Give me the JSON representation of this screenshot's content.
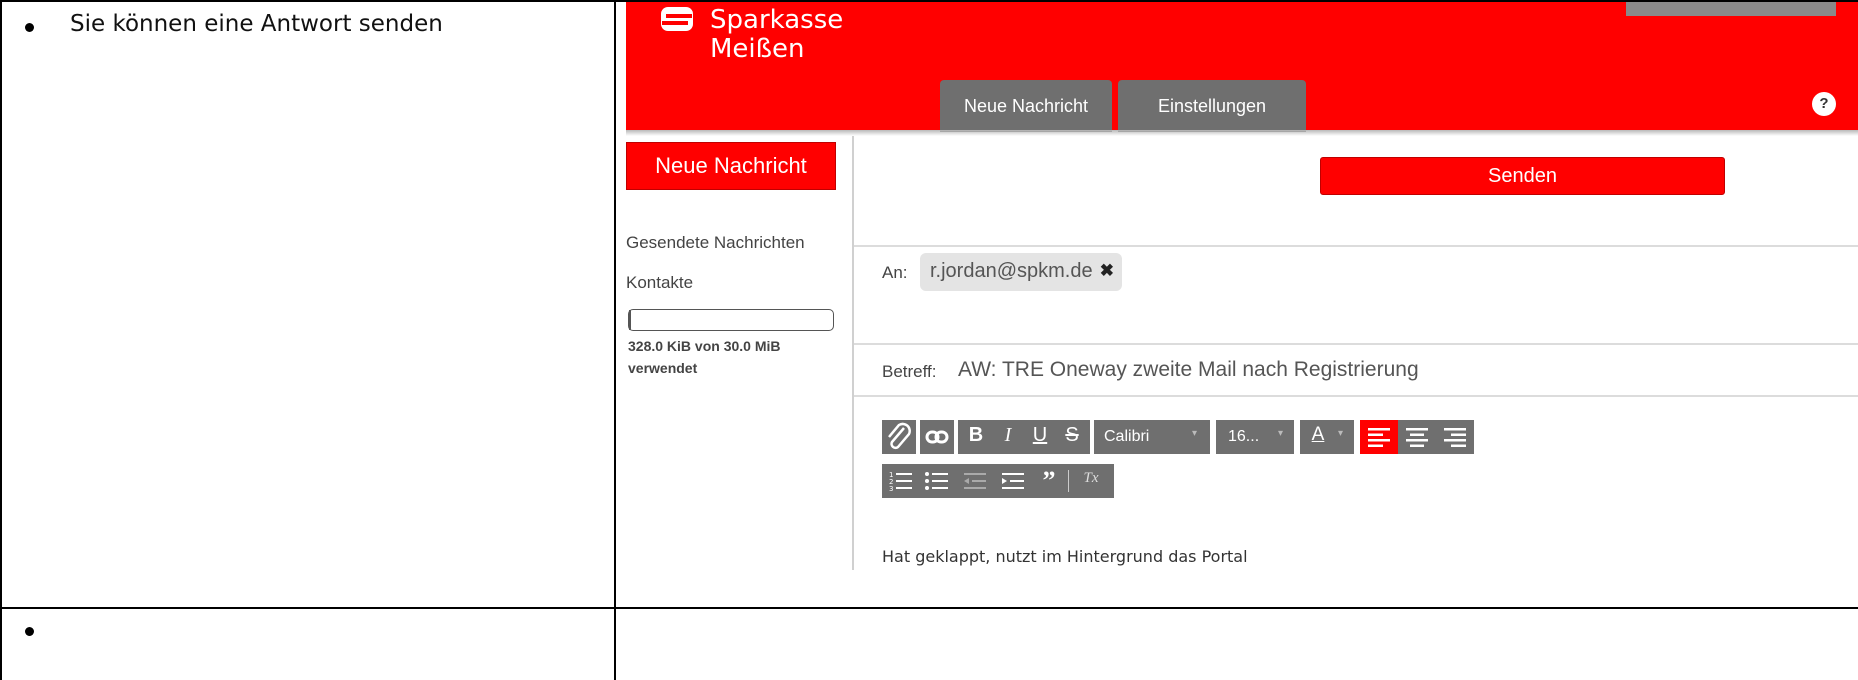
{
  "doc": {
    "row1_text": "Sie können eine Antwort senden",
    "row2_text": ""
  },
  "app": {
    "logo_line1": "Sparkasse",
    "logo_line2": "Meißen",
    "tabs": [
      {
        "label": "Neue Nachricht"
      },
      {
        "label": "Einstellungen"
      }
    ],
    "help_label": "?",
    "sidebar": {
      "new_message_button": "Neue Nachricht",
      "links": [
        {
          "label": "Gesendete Nachrichten"
        },
        {
          "label": "Kontakte"
        }
      ],
      "quota_text": "328.0 KiB von 30.0 MiB verwendet",
      "quota_fraction": 0.011
    },
    "compose": {
      "send_label": "Senden",
      "to_label": "An:",
      "recipient": "r.jordan@spkm.de",
      "remove_glyph": "✖",
      "subject_label": "Betreff:",
      "subject_value": "AW: TRE Oneway zweite Mail nach Registrierung",
      "toolbar": {
        "attach_icon": "paperclip-icon",
        "link_icon": "link-icon",
        "bold": "B",
        "italic": "I",
        "underline": "U",
        "strike": "S",
        "font_value": "Calibri",
        "size_value": "16...",
        "color_label": "A",
        "clear_format": "Tx",
        "quote": "”"
      },
      "body_text": "Hat geklappt, nutzt im Hintergrund das Portal"
    },
    "colors": {
      "brand_red": "#ff0000",
      "toolbar_gray": "#6f6f6f"
    }
  }
}
